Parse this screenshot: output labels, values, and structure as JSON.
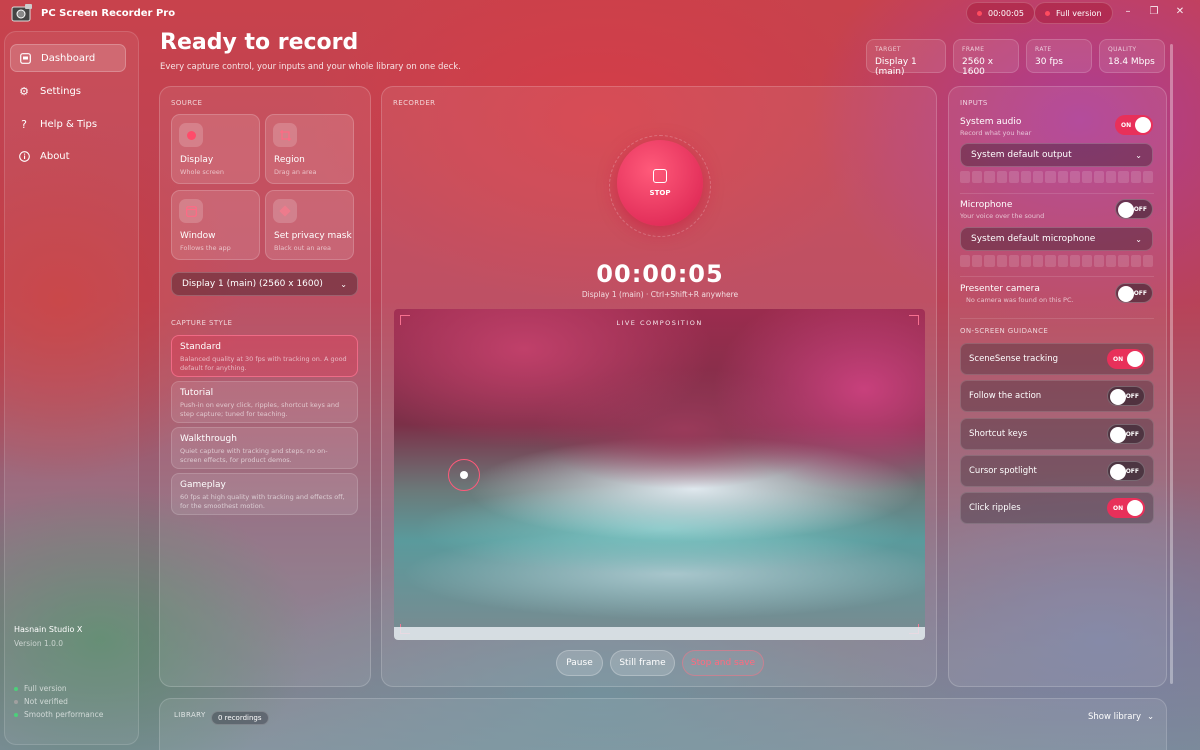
{
  "app": {
    "title": "PC Screen Recorder Pro"
  },
  "titlebar": {
    "timer": "00:00:05",
    "version_badge": "Full version"
  },
  "window_controls": {
    "minimize": "–",
    "maximize": "❐",
    "close": "✕"
  },
  "sidebar": {
    "items": [
      {
        "label": "Dashboard",
        "icon": "dashboard-icon",
        "active": true
      },
      {
        "label": "Settings",
        "icon": "gear-icon",
        "active": false
      },
      {
        "label": "Help & Tips",
        "icon": "question-icon",
        "active": false
      },
      {
        "label": "About",
        "icon": "info-icon",
        "active": false
      }
    ],
    "studio": "Hasnain Studio X",
    "version": "Version 1.0.0",
    "status": [
      {
        "label": "Full version",
        "color": "#4cd07a"
      },
      {
        "label": "Not verified",
        "color": "#a0a0a0"
      },
      {
        "label": "Smooth performance",
        "color": "#4cd07a"
      }
    ]
  },
  "header": {
    "title": "Ready to record",
    "subtitle": "Every capture control, your inputs and your whole library on one deck.",
    "stats": [
      {
        "key": "TARGET",
        "value": "Display 1 (main)"
      },
      {
        "key": "FRAME",
        "value": "2560 x 1600"
      },
      {
        "key": "RATE",
        "value": "30 fps"
      },
      {
        "key": "QUALITY",
        "value": "18.4 Mbps"
      }
    ]
  },
  "source": {
    "section": "SOURCE",
    "tiles": [
      {
        "title": "Display",
        "subtitle": "Whole screen",
        "icon": "display-icon"
      },
      {
        "title": "Region",
        "subtitle": "Drag an area",
        "icon": "crop-icon"
      },
      {
        "title": "Window",
        "subtitle": "Follows the app",
        "icon": "window-icon"
      },
      {
        "title": "Set privacy mask",
        "subtitle": "Black out an area",
        "icon": "mask-icon"
      }
    ],
    "display_select": "Display 1 (main)  (2560 x 1600)",
    "capture_style_label": "CAPTURE STYLE",
    "styles": [
      {
        "title": "Standard",
        "desc": "Balanced quality at 30 fps with tracking on. A good default for anything.",
        "active": true
      },
      {
        "title": "Tutorial",
        "desc": "Push-in on every click, ripples, shortcut keys and step capture; tuned for teaching.",
        "active": false
      },
      {
        "title": "Walkthrough",
        "desc": "Quiet capture with tracking and steps, no on-screen effects, for product demos.",
        "active": false
      },
      {
        "title": "Gameplay",
        "desc": "60 fps at high quality with tracking and effects off, for the smoothest motion.",
        "active": false
      }
    ]
  },
  "recorder": {
    "section": "RECORDER",
    "stop_label": "STOP",
    "timer": "00:00:05",
    "timer_sub": "Display 1 (main)  ·  Ctrl+Shift+R anywhere",
    "preview_label": "LIVE COMPOSITION",
    "buttons": {
      "pause": "Pause",
      "still": "Still frame",
      "stop_save": "Stop and save"
    }
  },
  "inputs": {
    "section": "INPUTS",
    "system_audio": {
      "label": "System audio",
      "sub": "Record what you hear",
      "state": "ON"
    },
    "system_select": "System default output",
    "microphone": {
      "label": "Microphone",
      "sub": "Your voice over the sound",
      "state": "OFF"
    },
    "mic_select": "System default microphone",
    "camera": {
      "label": "Presenter camera",
      "sub": "No camera was found on this PC.",
      "state": "OFF"
    },
    "guidance_label": "ON-SCREEN GUIDANCE",
    "guidance": [
      {
        "label": "SceneSense tracking",
        "state": "ON"
      },
      {
        "label": "Follow the action",
        "state": "OFF"
      },
      {
        "label": "Shortcut keys",
        "state": "OFF"
      },
      {
        "label": "Cursor spotlight",
        "state": "OFF"
      },
      {
        "label": "Click ripples",
        "state": "ON"
      }
    ]
  },
  "library": {
    "label": "LIBRARY",
    "count": "0 recordings",
    "toggle": "Show library"
  }
}
